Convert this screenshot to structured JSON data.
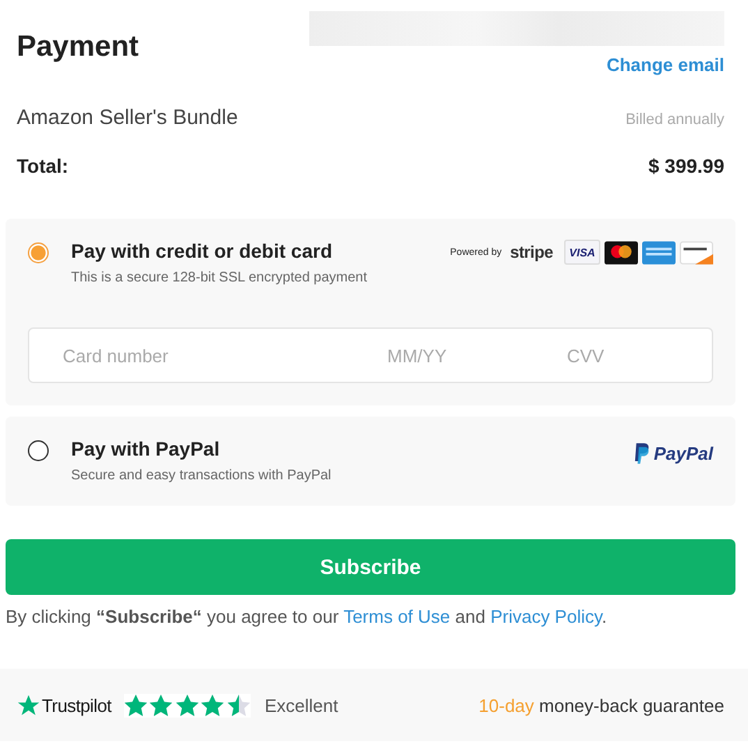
{
  "header": {
    "title": "Payment",
    "change_email": "Change email"
  },
  "product": {
    "name": "Amazon Seller's Bundle",
    "billing": "Billed annually"
  },
  "total": {
    "label": "Total:",
    "amount": "$ 399.99"
  },
  "methods": [
    {
      "kind": "card",
      "title": "Pay with credit or debit card",
      "subtitle": "This is a secure 128-bit SSL encrypted payment",
      "selected": true,
      "powered_by": "Powered by",
      "brand": "stripe",
      "visa": "VISA",
      "fields": [
        {
          "placeholder": "Card number"
        },
        {
          "placeholder": "MM/YY"
        },
        {
          "placeholder": "CVV"
        }
      ]
    },
    {
      "kind": "paypal",
      "title": "Pay with PayPal",
      "subtitle": "Secure and easy transactions with PayPal",
      "selected": false,
      "brand": "PayPal"
    }
  ],
  "subscribe": {
    "label": "Subscribe"
  },
  "agreement": {
    "before": "By clicking **“Subscribe“** you agree to our",
    "terms": "Terms of Use",
    "middle": "and",
    "privacy": "Privacy Policy",
    "after": "."
  },
  "footer": {
    "trustpilot": "Trustpilot",
    "stars": 4.5,
    "rating": "Excellent",
    "guarantee_highlight": "10-day",
    "guarantee": "money-back guarantee"
  }
}
